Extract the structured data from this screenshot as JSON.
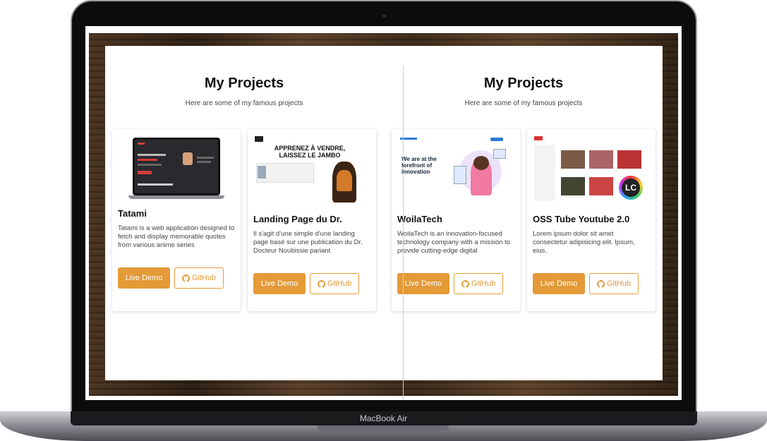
{
  "device": {
    "model_label": "MacBook Air"
  },
  "sections": [
    {
      "title": "My Projects",
      "subtitle": "Here are some of my famous projects",
      "projects": [
        {
          "name": "Tatami",
          "description": "Tatami is a web application designed to fetch and display memorable quotes from various anime series",
          "demo_label": "Live Demo",
          "github_label": "GitHub",
          "thumb_text": []
        },
        {
          "name": "Landing Page du Dr.",
          "description": "Il s'agit d'une simple d'une landing page basé sur une publication du Dr. Docteur Noubissie pariant",
          "demo_label": "Live Demo",
          "github_label": "GitHub",
          "thumb_text": [
            "APPRENEZ À VENDRE,",
            "LAISSEZ LE JAMBO"
          ]
        }
      ]
    },
    {
      "title": "My Projects",
      "subtitle": "Here are some of my famous projects",
      "projects": [
        {
          "name": "WoilaTech",
          "description": "WoilaTech is an innovation-focused technology company with a mission to provide cutting-edge digital",
          "demo_label": "Live Demo",
          "github_label": "GitHub",
          "thumb_text": [
            "We are at the",
            "forefront of",
            "innovation"
          ]
        },
        {
          "name": "OSS Tube Youtube 2.0",
          "description": "Lorem ipsum dolor sit amet consectetur adipisicing elit. Ipsum, eius.",
          "demo_label": "Live Demo",
          "github_label": "GitHub",
          "thumb_text": [
            "LC"
          ]
        }
      ]
    }
  ],
  "colors": {
    "accent": "#e39a37",
    "card_bg": "#ffffff",
    "frame_wood": "#4a3320"
  },
  "icons": {
    "github": "github-icon"
  }
}
